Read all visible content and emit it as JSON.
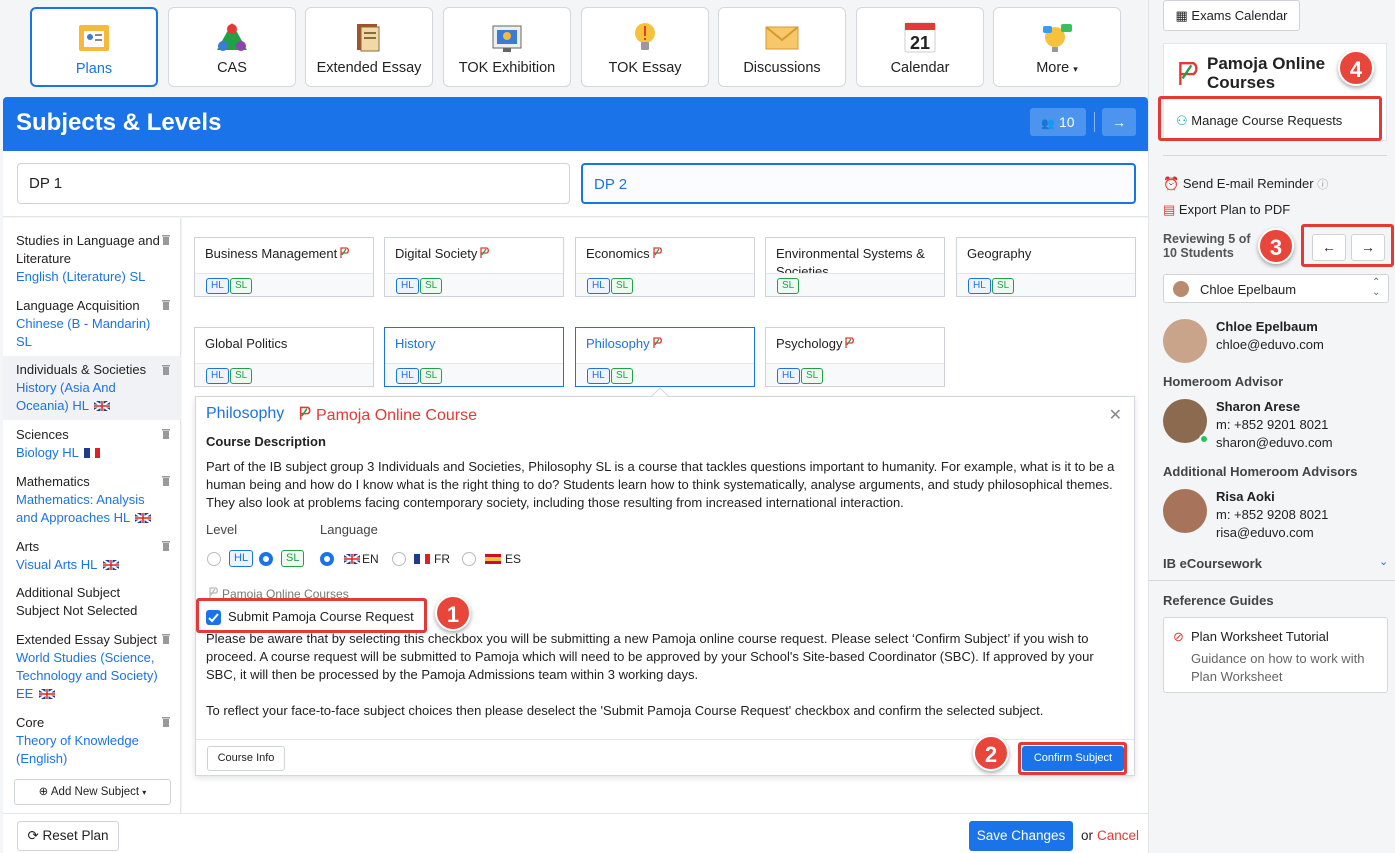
{
  "nav": {
    "tiles": [
      {
        "label": "Plans",
        "icon": "plans-icon"
      },
      {
        "label": "CAS",
        "icon": "cas-icon"
      },
      {
        "label": "Extended Essay",
        "icon": "extended-essay-icon"
      },
      {
        "label": "TOK Exhibition",
        "icon": "tok-exhibition-icon"
      },
      {
        "label": "TOK Essay",
        "icon": "tok-essay-icon"
      },
      {
        "label": "Discussions",
        "icon": "discussions-icon"
      },
      {
        "label": "Calendar",
        "icon": "calendar-icon",
        "calendar_day": "21"
      },
      {
        "label": "More",
        "icon": "more-icon"
      }
    ]
  },
  "header": {
    "title": "Subjects & Levels",
    "count": "10"
  },
  "dp_tabs": [
    "DP 1",
    "DP 2"
  ],
  "subjects": [
    {
      "name": "Studies in Language and Literature",
      "value": "English (Literature) SL"
    },
    {
      "name": "Language Acquisition",
      "value": "Chinese (B - Mandarin) SL"
    },
    {
      "name": "Individuals & Societies",
      "value": "History (Asia And Oceania) HL"
    },
    {
      "name": "Sciences",
      "value": "Biology HL"
    },
    {
      "name": "Mathematics",
      "value": "Mathematics: Analysis and Approaches HL"
    },
    {
      "name": "Arts",
      "value": "Visual Arts HL"
    },
    {
      "name": "Additional Subject",
      "value": "Subject Not Selected"
    },
    {
      "name": "Extended Essay Subject",
      "value": "World Studies (Science, Technology and Society) EE"
    },
    {
      "name": "Core",
      "value": "Theory of Knowledge (English)"
    }
  ],
  "add_subject_label": "Add New Subject",
  "cards": [
    {
      "title": "Business Management",
      "tags": [
        "HL",
        "SL"
      ]
    },
    {
      "title": "Digital Society",
      "tags": [
        "HL",
        "SL"
      ]
    },
    {
      "title": "Economics",
      "tags": [
        "HL",
        "SL"
      ]
    },
    {
      "title": "Environmental Systems & Societies",
      "tags": [
        "SL"
      ]
    },
    {
      "title": "Geography",
      "tags": [
        "HL",
        "SL"
      ]
    },
    {
      "title": "Global Politics",
      "tags": [
        "HL",
        "SL"
      ]
    },
    {
      "title": "History",
      "tags": [
        "HL",
        "SL"
      ]
    },
    {
      "title": "Philosophy",
      "tags": [
        "HL",
        "SL"
      ]
    },
    {
      "title": "Psychology",
      "tags": [
        "HL",
        "SL"
      ]
    }
  ],
  "panel": {
    "title": "Philosophy",
    "pamoja_label": "Pamoja Online Course",
    "desc_heading": "Course Description",
    "description": "Part of the IB subject group 3 Individuals and Societies, Philosophy SL is a course that tackles questions important to humanity. For example, what is it to be a human being and how do I know what is the right thing to do? Students learn how to think systematically, analyse arguments, and study philosophical themes. They also look at problems facing contemporary society, including those resulting from increased international interaction.",
    "level_label": "Level",
    "language_label": "Language",
    "levels": [
      "HL",
      "SL"
    ],
    "languages": [
      "EN",
      "FR",
      "ES"
    ],
    "pamoja_courses_label": "Pamoja Online Courses",
    "checkbox_label": "Submit Pamoja Course Request",
    "notice1": "Please be aware that by selecting this checkbox you will be submitting a new Pamoja online course request. Please select ‘Confirm Subject’ if you wish to proceed. A course request will be submitted to Pamoja which will need to be approved by your School's Site-based Coordinator (SBC). If approved by your SBC, it will then be processed by the Pamoja Admissions team within 3 working days.",
    "notice2": "To reflect your face-to-face subject choices then please deselect the 'Submit Pamoja Course Request' checkbox and confirm the selected subject.",
    "course_info": "Course Info",
    "confirm": "Confirm Subject"
  },
  "footer": {
    "reset": "Reset Plan",
    "save": "Save Changes",
    "or": "or",
    "cancel": "Cancel"
  },
  "right": {
    "exams_calendar": "Exams Calendar",
    "pamoja_title": "Pamoja Online Courses",
    "manage_requests": "Manage Course Requests",
    "send_reminder": "Send E-mail Reminder",
    "export_pdf": "Export Plan to PDF",
    "reviewing": "Reviewing 5 of 10 Students",
    "student_select": "Chloe Epelbaum",
    "student": {
      "name": "Chloe Epelbaum",
      "email": "chloe@eduvo.com"
    },
    "homeroom_label": "Homeroom Advisor",
    "homeroom": {
      "name": "Sharon Arese",
      "phone": "m: +852 9201 8021",
      "email": "sharon@eduvo.com"
    },
    "additional_label": "Additional Homeroom Advisors",
    "additional": {
      "name": "Risa Aoki",
      "phone": "m: +852 9208 8021",
      "email": "risa@eduvo.com"
    },
    "ib_ecoursework": "IB eCoursework",
    "reference_guides": "Reference Guides",
    "guide_title": "Plan Worksheet Tutorial",
    "guide_desc": "Guidance on how to work with Plan Worksheet"
  },
  "callouts": [
    "1",
    "2",
    "3",
    "4"
  ],
  "colors": {
    "primary": "#1a73e8",
    "danger": "#e53935",
    "success": "#22a046"
  }
}
